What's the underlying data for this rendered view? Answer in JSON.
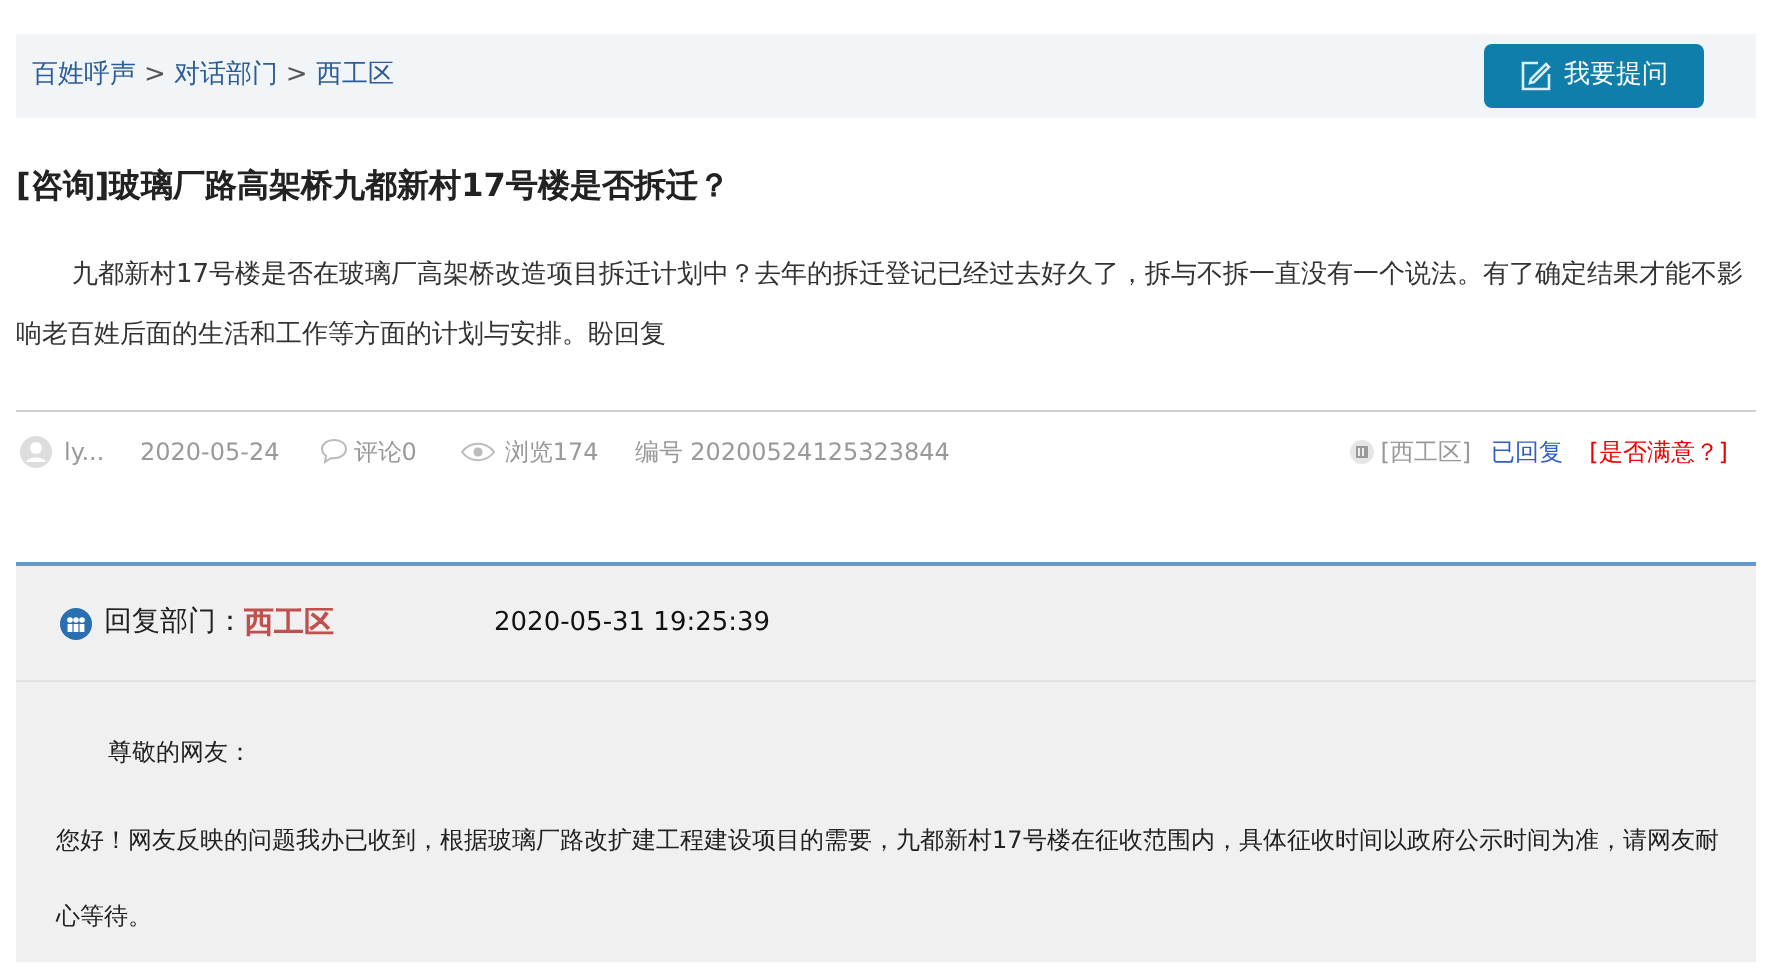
{
  "breadcrumb": [
    "百姓呼声",
    "对话部门",
    "西工区"
  ],
  "breadcrumb_separator": ">",
  "ask_button": {
    "label": "我要提问"
  },
  "question": {
    "tag": "[咨询]",
    "title": "玻璃厂路高架桥九都新村17号楼是否拆迁？",
    "body": "九都新村17号楼是否在玻璃厂高架桥改造项目拆迁计划中？去年的拆迁登记已经过去好久了，拆与不拆一直没有一个说法。有了确定结果才能不影响老百姓后面的生活和工作等方面的计划与安排。盼回复"
  },
  "meta": {
    "user": "ly...",
    "date": "2020-05-24",
    "comments": "评论0",
    "views": "浏览174",
    "number": "编号 20200524125323844",
    "department": "[西工区]",
    "status": "已回复",
    "satisfaction": "[是否满意？]"
  },
  "reply": {
    "label": "回复部门：",
    "department": "西工区",
    "time": "2020-05-31 19:25:39",
    "greeting": "尊敬的网友：",
    "body": "您好！网友反映的问题我办已收到，根据玻璃厂路改扩建工程建设项目的需要，九都新村17号楼在征收范围内，具体征收时间以政府公示时间为准，请网友耐心等待。"
  }
}
